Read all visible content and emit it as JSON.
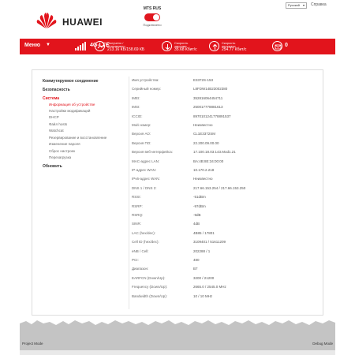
{
  "header": {
    "language": "Русский",
    "help": "Справка",
    "brand": "HUAWEI",
    "operator_name": "MTS RUS",
    "connection_state": "Подключено"
  },
  "statusbar": {
    "menu": "Меню",
    "network": "4G-LTE",
    "traffic_label_1": "Получено /",
    "traffic_label_2": "Отправлено",
    "traffic_value": "213.16 КБ/158.69 КБ",
    "download_label_1": "Скорость",
    "download_label_2": "загрузки",
    "download_value": "35.68 Кбит/с",
    "upload_label_1": "Скорость",
    "upload_label_2": "передачи",
    "upload_value": "254.77 Кбит/с",
    "messages": "0"
  },
  "nav": {
    "items": [
      {
        "label": "Коммутируемое соединение",
        "type": "head"
      },
      {
        "label": "Безопасность",
        "type": "head"
      },
      {
        "label": "Система",
        "type": "head-active"
      },
      {
        "label": "Информация об устройстве",
        "type": "sub-active"
      },
      {
        "label": "Настройки модификаций",
        "type": "sub"
      },
      {
        "label": "DHCP",
        "type": "sub"
      },
      {
        "label": "Файл hosts",
        "type": "sub"
      },
      {
        "label": "Watchcat",
        "type": "sub"
      },
      {
        "label": "Резервирование и восстановление",
        "type": "sub"
      },
      {
        "label": "Изменение пароля",
        "type": "sub"
      },
      {
        "label": "Сброс настроек",
        "type": "sub"
      },
      {
        "label": "Перезагрузка",
        "type": "sub"
      },
      {
        "label": "Обновить",
        "type": "head"
      }
    ]
  },
  "device_info": [
    {
      "key": "Имя устройства:",
      "value": "E3372S-153"
    },
    {
      "key": "Серийный номер:",
      "value": "L8FDW14B23002380"
    },
    {
      "key": "IMEI:",
      "value": "352816064454711"
    },
    {
      "key": "IMSI:",
      "value": "250017778881613"
    },
    {
      "key": "ICCID:",
      "value": "8970101241778891537"
    },
    {
      "key": "Мой номер:",
      "value": "Неизвестно"
    },
    {
      "key": "Версия АО:",
      "value": "CL1E3372SM"
    },
    {
      "key": "Версия ПО:",
      "value": "22.200.09.00.00"
    },
    {
      "key": "Версия веб-интерфейса:",
      "value": "17.100.18.03.143.Mod1.21"
    },
    {
      "key": "MAC-адрес LAN:",
      "value": "BA:4B:8E:34:00:00"
    },
    {
      "key": "IP-адрес WAN:",
      "value": "10.170.2.218"
    },
    {
      "key": "IPv6-адрес WAN:",
      "value": "Неизвестно"
    },
    {
      "key": "DNS 1 / DNS 2:",
      "value": "217.66.153.254 / 217.66.153.250"
    },
    {
      "key": "RSSI:",
      "value": "-51dBm"
    },
    {
      "key": "RSRP:",
      "value": "-97dBm"
    },
    {
      "key": "RSRQ:",
      "value": "-9dB"
    },
    {
      "key": "SINR:",
      "value": "4dB"
    },
    {
      "key": "LAC (hex/dec):",
      "value": "4B85 / 17801"
    },
    {
      "key": "Cell ID (hex/dec):",
      "value": "3109401 / 51611209"
    },
    {
      "key": "eNB / Cell:",
      "value": "202288 / 1"
    },
    {
      "key": "PCI:",
      "value": "480"
    },
    {
      "key": "Диапазон:",
      "value": "B7"
    },
    {
      "key": "EARFCN (Down/Up):",
      "value": "3200 / 21200"
    },
    {
      "key": "Frequency (Down/Up):",
      "value": "2665.0 / 2545.0 MHz"
    },
    {
      "key": "Bandwidth (Down/Up):",
      "value": "10 / 10 MHz"
    }
  ],
  "footer": {
    "left": "Project Mode",
    "right": "Debug Mode"
  },
  "colors": {
    "accent": "#e2141c",
    "footer_gray": "#c4c4c4"
  }
}
